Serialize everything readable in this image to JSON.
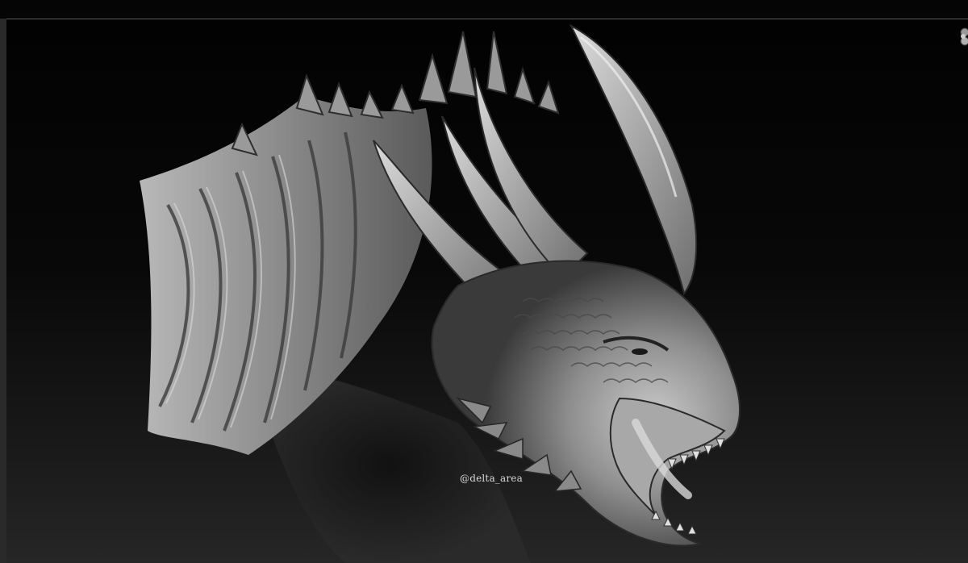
{
  "viewport": {
    "watermark": "@delta_area",
    "subject_icon": "dragon-sculpt-icon"
  },
  "toolbar": {
    "corner_tool_icon": "navigation-gizmo-icon"
  },
  "colors": {
    "background": "#060606",
    "sculpt_base": "#8c8c8c",
    "sculpt_highlight": "#d0d0d0"
  }
}
